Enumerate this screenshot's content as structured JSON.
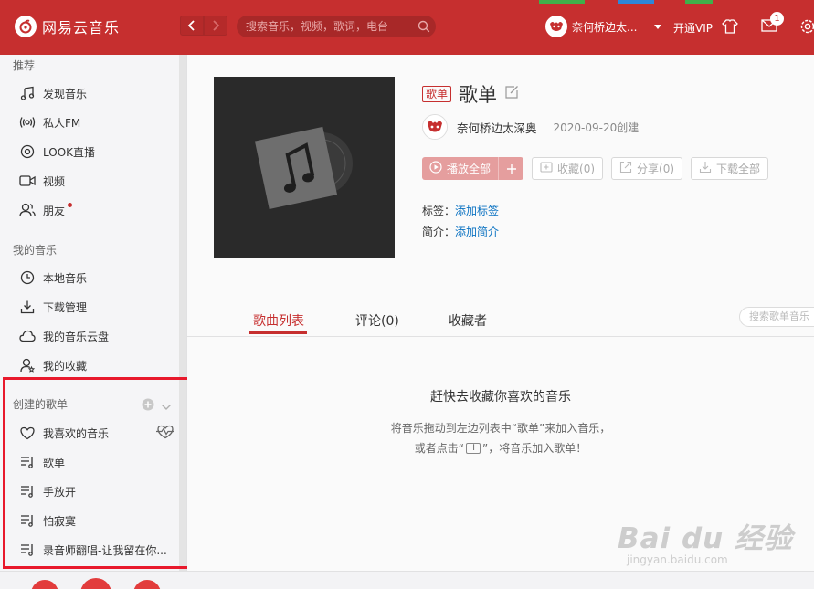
{
  "app": {
    "name": "网易云音乐",
    "brand_color": "#c62f2f"
  },
  "topbar": {
    "search_placeholder": "搜索音乐，视频，歌词，电台",
    "user_name": "奈何桥边太...",
    "vip_label": "开通VIP",
    "mail_count": "1"
  },
  "sidebar": {
    "recommend_title": "推荐",
    "recommend": [
      {
        "label": "发现音乐",
        "icon": "music-note-icon"
      },
      {
        "label": "私人FM",
        "icon": "radio-icon"
      },
      {
        "label": "LOOK直播",
        "icon": "live-icon"
      },
      {
        "label": "视频",
        "icon": "video-icon"
      },
      {
        "label": "朋友",
        "icon": "friends-icon"
      }
    ],
    "mymusic_title": "我的音乐",
    "mymusic": [
      {
        "label": "本地音乐",
        "icon": "local-music-icon"
      },
      {
        "label": "下载管理",
        "icon": "download-icon"
      },
      {
        "label": "我的音乐云盘",
        "icon": "cloud-icon"
      },
      {
        "label": "我的收藏",
        "icon": "collect-icon"
      }
    ],
    "created_title": "创建的歌单",
    "created": [
      {
        "label": "我喜欢的音乐",
        "icon": "heart-icon"
      },
      {
        "label": "歌单",
        "icon": "playlist-icon"
      },
      {
        "label": "手放开",
        "icon": "playlist-icon"
      },
      {
        "label": "怕寂寞",
        "icon": "playlist-icon"
      },
      {
        "label": "录音师翻唱-让我留在你...",
        "icon": "playlist-icon"
      }
    ]
  },
  "playlist": {
    "tag": "歌单",
    "title": "歌单",
    "creator": "奈何桥边太深奥",
    "created_date": "2020-09-20创建",
    "play_all": "播放全部",
    "collect": "收藏(0)",
    "share": "分享(0)",
    "download_all": "下载全部",
    "tags_label": "标签：",
    "tags_link": "添加标签",
    "intro_label": "简介：",
    "intro_link": "添加简介"
  },
  "tabs": [
    {
      "label": "歌曲列表",
      "active": true
    },
    {
      "label": "评论(0)",
      "active": false
    },
    {
      "label": "收藏者",
      "active": false
    }
  ],
  "tab_search_placeholder": "搜索歌单音乐",
  "empty": {
    "title": "赶快去收藏你喜欢的音乐",
    "line1": "将音乐拖动到左边列表中“歌单”来加入音乐，",
    "line2_pre": "或者点击“",
    "line2_post": "”，将音乐加入歌单！"
  },
  "watermark": {
    "big": "Bai du 经验",
    "small": "jingyan.baidu.com"
  }
}
